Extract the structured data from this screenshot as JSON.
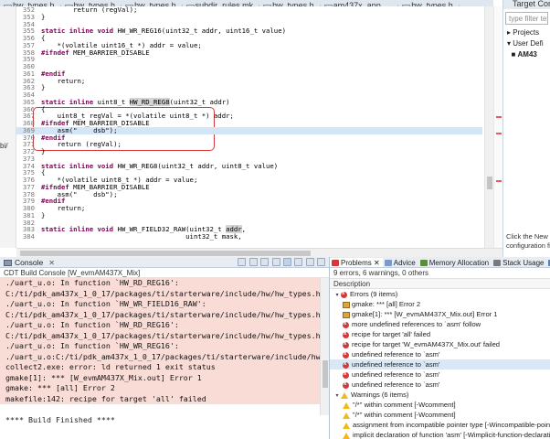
{
  "editor_tabs": [
    "hw_types.h",
    "hw_types.h",
    "hw_types.h",
    "subdir_rules.mk",
    "hw_types.h",
    "am437x_app_...",
    "hw_types.h"
  ],
  "code": [
    {
      "n": "352",
      "parts": [
        [
          "",
          "        return (regVal);"
        ]
      ]
    },
    {
      "n": "353",
      "parts": [
        [
          "",
          "}"
        ]
      ]
    },
    {
      "n": "354",
      "parts": [
        [
          "",
          ""
        ]
      ]
    },
    {
      "n": "355",
      "parts": [
        [
          "kw",
          "static inline void"
        ],
        [
          "",
          " HW_WR_REG16(uint32_t addr, uint16_t value)"
        ]
      ]
    },
    {
      "n": "356",
      "parts": [
        [
          "",
          "{"
        ]
      ]
    },
    {
      "n": "357",
      "parts": [
        [
          "",
          "    *(volatile uint16_t *) addr = value;"
        ]
      ]
    },
    {
      "n": "358",
      "parts": [
        [
          "pp",
          "#ifndef"
        ],
        [
          "",
          " MEM_BARRIER_DISABLE"
        ]
      ]
    },
    {
      "n": "359",
      "parts": [
        [
          "",
          ""
        ]
      ]
    },
    {
      "n": "360",
      "parts": [
        [
          "",
          ""
        ]
      ]
    },
    {
      "n": "361",
      "parts": [
        [
          "pp",
          "#endif"
        ]
      ]
    },
    {
      "n": "362",
      "parts": [
        [
          "",
          "    return;"
        ]
      ]
    },
    {
      "n": "363",
      "parts": [
        [
          "",
          "}"
        ]
      ]
    },
    {
      "n": "364",
      "parts": [
        [
          "",
          ""
        ]
      ]
    },
    {
      "n": "365",
      "parts": [
        [
          "kw",
          "static inline"
        ],
        [
          "",
          " uint8_t "
        ],
        [
          "occ",
          "HW_RD_REG8"
        ],
        [
          "",
          "(uint32_t addr)"
        ]
      ]
    },
    {
      "n": "366",
      "parts": [
        [
          "",
          "{"
        ]
      ]
    },
    {
      "n": "367",
      "parts": [
        [
          "",
          "    uint8_t regVal = *(volatile uint8_t *) addr;"
        ]
      ]
    },
    {
      "n": "368",
      "parts": [
        [
          "pp",
          "#ifndef"
        ],
        [
          "",
          " MEM_BARRIER_DISABLE"
        ]
      ]
    },
    {
      "n": "369",
      "parts": [
        [
          "",
          "    asm(\"    dsb\");"
        ]
      ]
    },
    {
      "n": "370",
      "parts": [
        [
          "pp",
          "#endif"
        ]
      ]
    },
    {
      "n": "371",
      "parts": [
        [
          "",
          "    return (regVal);"
        ]
      ]
    },
    {
      "n": "372",
      "parts": [
        [
          "",
          "}"
        ]
      ]
    },
    {
      "n": "373",
      "parts": [
        [
          "",
          ""
        ]
      ]
    },
    {
      "n": "374",
      "parts": [
        [
          "kw",
          "static inline void"
        ],
        [
          "",
          " HW_WR_REG8(uint32_t addr, uint8_t value)"
        ]
      ]
    },
    {
      "n": "375",
      "parts": [
        [
          "",
          "{"
        ]
      ]
    },
    {
      "n": "376",
      "parts": [
        [
          "",
          "    *(volatile uint8_t *) addr = value;"
        ]
      ]
    },
    {
      "n": "377",
      "parts": [
        [
          "pp",
          "#ifndef"
        ],
        [
          "",
          " MEM_BARRIER_DISABLE"
        ]
      ]
    },
    {
      "n": "378",
      "parts": [
        [
          "",
          "    asm(\"    dsb\");"
        ]
      ]
    },
    {
      "n": "379",
      "parts": [
        [
          "pp",
          "#endif"
        ]
      ]
    },
    {
      "n": "380",
      "parts": [
        [
          "",
          "    return;"
        ]
      ]
    },
    {
      "n": "381",
      "parts": [
        [
          "",
          "}"
        ]
      ]
    },
    {
      "n": "382",
      "parts": [
        [
          "",
          ""
        ]
      ]
    },
    {
      "n": "383",
      "parts": [
        [
          "kw",
          "static inline void"
        ],
        [
          "",
          " HW_WR_FIELD32_RAW(uint32_t "
        ],
        [
          "occ",
          "addr"
        ],
        [
          "",
          ","
        ]
      ]
    },
    {
      "n": "384",
      "parts": [
        [
          "",
          "                                    uint32_t mask,"
        ]
      ]
    }
  ],
  "side_label": "bi/",
  "outline": {
    "title": "Target Config",
    "filter_placeholder": "type filter text",
    "items": [
      "Projects",
      "User Defi",
      "AM43"
    ],
    "note_line1": "Click the New b",
    "note_line2": "configuration fil"
  },
  "console": {
    "tab_label": "Console",
    "subtitle": "CDT Build Console [W_evmAM437X_Mix]",
    "lines": [
      {
        "text": "./uart_u.o: In function `HW_RD_REG16':",
        "style": "err"
      },
      {
        "text": "C:/ti/pdk_am437x_1_0_17/packages/ti/starterware/include/hw/hw_types.h",
        "style": "err"
      },
      {
        "text": "./uart_u.o: In function `HW_WR_FIELD16_RAW':",
        "style": "err"
      },
      {
        "text": "C:/ti/pdk_am437x_1_0_17/packages/ti/starterware/include/hw/hw_types.h",
        "style": "err"
      },
      {
        "text": "./uart_u.o: In function `HW_RD_REG16':",
        "style": "err"
      },
      {
        "text": "C:/ti/pdk_am437x_1_0_17/packages/ti/starterware/include/hw/hw_types.h",
        "style": "err"
      },
      {
        "text": "./uart_u.o: In function `HW_WR_REG16':",
        "style": "err"
      },
      {
        "text": "./uart_u.o:C:/ti/pdk_am437x_1_0_17/packages/ti/starterware/include/hw/",
        "style": "err"
      },
      {
        "text": "collect2.exe: error: ld returned 1 exit status",
        "style": "err"
      },
      {
        "text": "gmake[1]: *** [W_evmAM437X_Mix.out] Error 1",
        "style": "err"
      },
      {
        "text": "gmake: *** [all] Error 2",
        "style": "err"
      },
      {
        "text": "makefile:142: recipe for target 'all' failed",
        "style": "err"
      },
      {
        "text": "",
        "style": "plain"
      },
      {
        "text": "**** Build Finished ****",
        "style": "plain"
      }
    ]
  },
  "problems": {
    "tabs": [
      "Problems",
      "Advice",
      "Memory Allocation",
      "Stack Usage",
      "Sea"
    ],
    "summary": "9 errors, 6 warnings, 0 others",
    "column": "Description",
    "rows": [
      {
        "kind": "group-error",
        "text": "Errors (9 items)"
      },
      {
        "kind": "gmake",
        "text": "gmake: *** [all] Error 2"
      },
      {
        "kind": "gmake",
        "text": "gmake[1]: *** [W_evmAM437X_Mix.out] Error 1"
      },
      {
        "kind": "error",
        "text": "more undefined references to `asm' follow"
      },
      {
        "kind": "error",
        "text": "recipe for target 'all' failed"
      },
      {
        "kind": "error",
        "text": "recipe for target 'W_evmAM437X_Mix.out' failed"
      },
      {
        "kind": "error",
        "text": "undefined reference to `asm'"
      },
      {
        "kind": "error-sel",
        "text": "undefined reference to `asm'"
      },
      {
        "kind": "error",
        "text": "undefined reference to `asm'"
      },
      {
        "kind": "error",
        "text": "undefined reference to `asm'"
      },
      {
        "kind": "group-warning",
        "text": "Warnings (6 items)"
      },
      {
        "kind": "warning",
        "text": "\"/*\" within comment [-Wcomment]"
      },
      {
        "kind": "warning",
        "text": "\"/*\" within comment [-Wcomment]"
      },
      {
        "kind": "warning",
        "text": "assignment from incompatible pointer type [-Wincompatible-pointer"
      },
      {
        "kind": "warning",
        "text": "implicit declaration of function 'asm' [-Wimplicit-function-declaration]"
      },
      {
        "kind": "warning",
        "text": "implicit declaration of function 'asm' [-Wimplicit-function-declaration]"
      }
    ]
  },
  "colors": {
    "error_bg": "#f9dcd6",
    "error_icon": "#d23a3a",
    "warning_icon": "#f2b91c",
    "keyword": "#7f0055",
    "box": "#d23a3a"
  }
}
